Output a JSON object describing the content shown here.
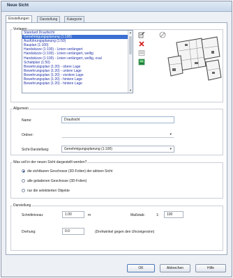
{
  "window": {
    "title": "Neue Sicht"
  },
  "tabs": [
    {
      "label": "Einstellungen"
    },
    {
      "label": "Darstellung"
    },
    {
      "label": "Kategorie"
    }
  ],
  "vorlagen": {
    "title": "Vorlagen",
    "items": [
      "Standard Draufsicht",
      "Genehmigungsplanung (1:100)",
      "Ausführungsplanung (1:50)",
      "Bauplan (1:100)",
      "Handskizze (1:100) - Linien verlängert",
      "Handskizze (1:100) - Linien verlängert, wellig",
      "Handskizze (1:100) - Linien verlängert, wellig, oval",
      "Schaltplan (1:50)",
      "Bewehrungsplan (1:20) - obere Lage",
      "Bewehrungsplan (1:20) - untere Lage",
      "Bewehrungsplan (1:20) - vordere Lage",
      "Bewehrungsplan (1:20) - hintere Lage",
      "Bewehrungsplan (1:20) - hintere Lage"
    ],
    "selected_index": 1,
    "icons": [
      "template-manage-icon",
      "delete-icon",
      "list-icon",
      "import-icon"
    ]
  },
  "allgemein": {
    "title": "Allgemein",
    "name_label": "Name:",
    "name_value": "Draufsicht",
    "ordner_label": "Ordner:",
    "ordner_value": "",
    "sicht_label": "Sicht-Darstellung:",
    "sicht_value": "Genehmigungsplanung (1:100)"
  },
  "darstellung_frage": {
    "title": "Was soll in der neuen Sicht dargestellt werden?",
    "options": [
      "die sichtbaren Geschosse (3D-Folien) der aktiven Sicht",
      "alle geladenen Geschosse (3D-Folien)",
      "nur die selektierten Objekte"
    ],
    "selected_index": 0
  },
  "darstellung": {
    "title": "Darstellung",
    "schnitt_label": "Schnittniveau:",
    "schnitt_value": "1.00",
    "schnitt_unit": "m",
    "massstab_label": "Maßstab:",
    "massstab_prefix": "1:",
    "massstab_value": "100",
    "drehung_label": "Drehung:",
    "drehung_value": "0.0",
    "drehung_hint": "(Drehwinkel gegen den Uhrzeigersinn)"
  },
  "buttons": {
    "ok": "OK",
    "cancel": "Abbrechen",
    "help": "Hilfe"
  }
}
